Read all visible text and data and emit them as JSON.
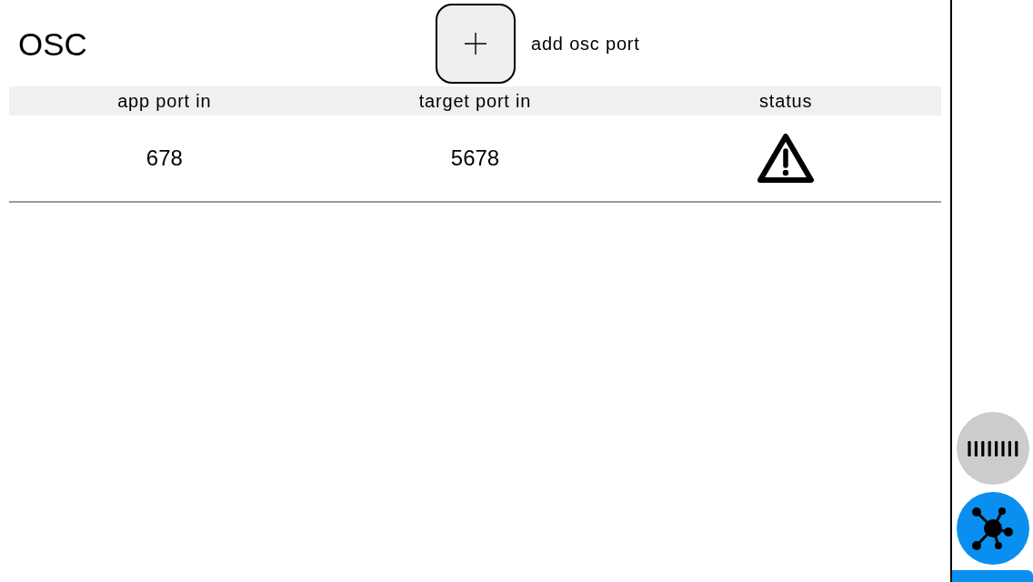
{
  "header": {
    "title": "OSC",
    "add_button_label": "add osc port"
  },
  "table": {
    "columns": [
      "app port in",
      "target port in",
      "status"
    ],
    "rows": [
      {
        "app_port_in": "678",
        "target_port_in": "5678",
        "warning": true
      }
    ]
  },
  "sidebar": {
    "items": [
      {
        "kind": "meter",
        "selected": false
      },
      {
        "kind": "network",
        "selected": true
      }
    ]
  }
}
